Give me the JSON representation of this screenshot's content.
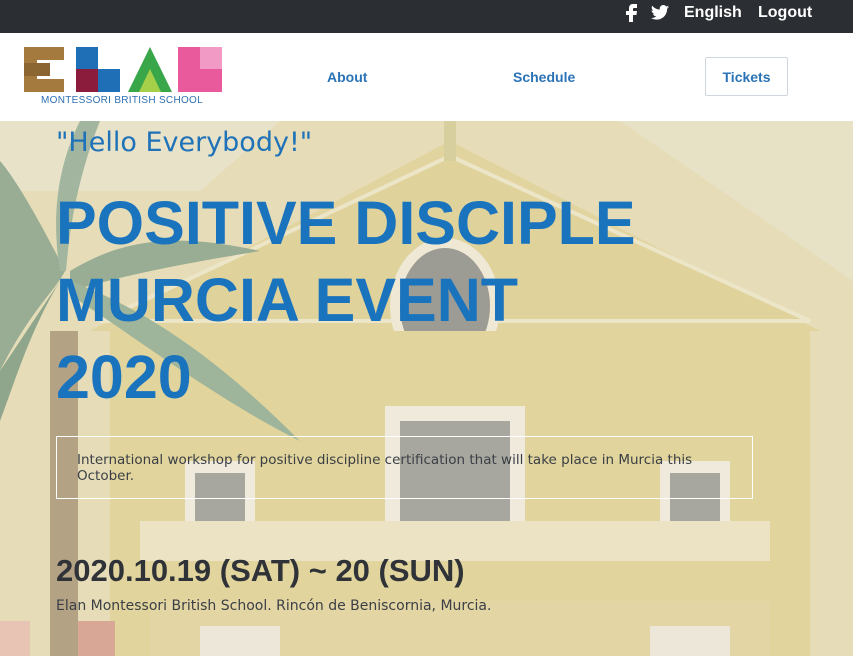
{
  "topbar": {
    "facebook_icon": "facebook-icon",
    "twitter_icon": "twitter-icon",
    "language": "English",
    "logout": "Logout"
  },
  "nav": {
    "logo_text": "MONTESSORI BRITISH SCHOOL",
    "about": "About",
    "schedule": "Schedule",
    "tickets": "Tickets"
  },
  "hero": {
    "greeting": "\"Hello Everybody!\"",
    "title_line1": "POSITIVE DISCIPLE",
    "title_line2": "MURCIA EVENT",
    "title_line3": "2020",
    "description": "International workshop for positive discipline certification that will take place in Murcia this October.",
    "date": "2020.10.19 (SAT) ~ 20 (SUN)",
    "location": "Elan Montessori British School. Rincón de Beniscornia, Murcia."
  },
  "colors": {
    "topbar": "#2b2f34",
    "accent_blue": "#1a73bd",
    "logo_brown": "#a47a3f",
    "logo_blue": "#1e6fb5",
    "logo_green": "#3aa64a",
    "logo_pink": "#e85a9c",
    "logo_maroon": "#8c1c3b"
  }
}
